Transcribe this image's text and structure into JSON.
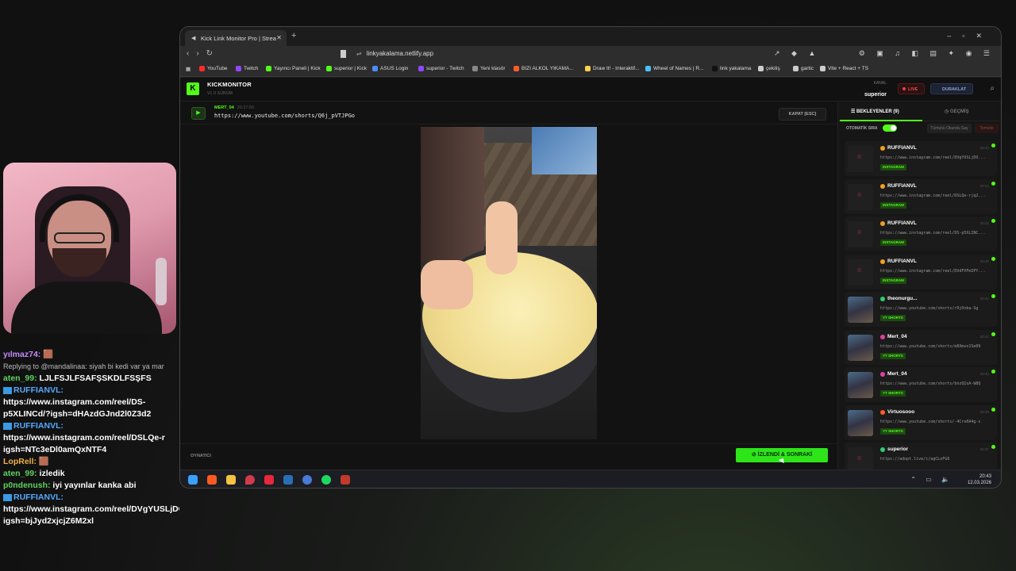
{
  "chat": [
    {
      "type": "partial",
      "text": "yılmaz74: 🟫"
    },
    {
      "type": "reply",
      "text": "Replying to @mandalinaa: siyah bi kedi var ya mar"
    },
    {
      "type": "msg",
      "user": "aten_99:",
      "user_color": "green",
      "text": "LJLFSJLFSAFŞSKDLFSŞFS"
    },
    {
      "type": "user_only",
      "user": "RUFFIANVL:",
      "user_color": "blue",
      "badge": true
    },
    {
      "type": "text_only",
      "text": "https://www.instagram.com/reel/DS-"
    },
    {
      "type": "text_only",
      "text": "p5XLINCd/?igsh=dHAzdGJnd2l0Z3d2"
    },
    {
      "type": "user_only",
      "user": "RUFFIANVL:",
      "user_color": "blue",
      "badge": true
    },
    {
      "type": "text_only",
      "text": "https://www.instagram.com/reel/DSLQe-r"
    },
    {
      "type": "text_only",
      "text": "igsh=NTc3eDl0amQxNTF4"
    },
    {
      "type": "msg",
      "user": "LopRell:",
      "user_color": "orange",
      "text": "🟫"
    },
    {
      "type": "msg",
      "user": "aten_99:",
      "user_color": "green",
      "text": "izledik"
    },
    {
      "type": "msg",
      "user": "p0ndenush:",
      "user_color": "green",
      "text": "iyi yayınlar kanka abi"
    },
    {
      "type": "user_only",
      "user": "RUFFIANVL:",
      "user_color": "blue",
      "badge": true
    },
    {
      "type": "text_only",
      "text": "https://www.instagram.com/reel/DVgYUSLjDO0/?"
    },
    {
      "type": "text_only",
      "text": "igsh=bjJyd2xjcjZ6M2xl"
    }
  ],
  "browser": {
    "tab_title": "Kick Link Monitor Pro | Strea",
    "url": "linkyakalama.netlify.app",
    "bookmarks": [
      {
        "label": "YouTube",
        "color": "#ff2a2a"
      },
      {
        "label": "Twitch",
        "color": "#9146ff"
      },
      {
        "label": "Yayıncı Paneli | Kick",
        "color": "#53fc18"
      },
      {
        "label": "superior | Kick",
        "color": "#53fc18"
      },
      {
        "label": "ASUS Login",
        "color": "#4a8cff"
      },
      {
        "label": "superior - Twitch",
        "color": "#9146ff"
      },
      {
        "label": "Yeni klasör",
        "color": "#888888"
      },
      {
        "label": "BIZI ALKOL YIKAMA...",
        "color": "#ff5a2a"
      },
      {
        "label": "Draw It! - Interaktif...",
        "color": "#ffd24a"
      },
      {
        "label": "Wheel of Names | R...",
        "color": "#4ac0ff"
      },
      {
        "label": "link yakalama",
        "color": "#111111"
      },
      {
        "label": "çekiliş",
        "color": "#cccccc"
      },
      {
        "label": "gartic",
        "color": "#cccccc"
      },
      {
        "label": "Vite + React + TS",
        "color": "#cccccc"
      }
    ]
  },
  "app": {
    "logo_letter": "K",
    "brand": "KICKMONITOR",
    "version": "V1.0 SÜRÜM",
    "channel_label": "KANAL",
    "channel_name": "superior",
    "live_label": "LIVE",
    "pause_label": "DURAKLAT",
    "now_playing": {
      "user": "MERT_04",
      "time": "20:37:56",
      "url": "https://www.youtube.com/shorts/Q6j_pVTJPGo",
      "close_label": "KAPAT [ESC]"
    },
    "player_label": "OYNATICI",
    "next_label": "İZLENDİ & SONRAKİ",
    "tabs": {
      "waiting": "BEKLEYENLER (9)",
      "history": "GEÇMİŞ"
    },
    "auto_label": "OTOMATİK SIRA",
    "mark_all_label": "Tümünü Okundu Say",
    "clear_label": "Temizle",
    "queue": [
      {
        "name": "RUFFIANVL",
        "dot": "#f0a020",
        "time": "20:42",
        "url": "https://www.instagram.com/reel/DVgYUSLjDO...",
        "badge": "INSTAGRAM",
        "thumb": "ig"
      },
      {
        "name": "RUFFIANVL",
        "dot": "#f0a020",
        "time": "20:41",
        "url": "https://www.instagram.com/reel/DSLQe-rjq2...",
        "badge": "INSTAGRAM",
        "thumb": "ig"
      },
      {
        "name": "RUFFIANVL",
        "dot": "#f0a020",
        "time": "20:41",
        "url": "https://www.instagram.com/reel/DS-p5XLINC...",
        "badge": "INSTAGRAM",
        "thumb": "ig"
      },
      {
        "name": "RUFFIANVL",
        "dot": "#f0a020",
        "time": "20:40",
        "url": "https://www.instagram.com/reel/DVdFXFmIPY...",
        "badge": "INSTAGRAM",
        "thumb": "ig"
      },
      {
        "name": "theonurgu...",
        "dot": "#2ecc71",
        "time": "20:41",
        "url": "https://www.youtube.com/shorts/r9jOvba-Sg",
        "badge": "YT SHORTS",
        "thumb": "yt"
      },
      {
        "name": "Mert_04",
        "dot": "#e040a0",
        "time": "20:41",
        "url": "https://www.youtube.com/shorts/m8Xmvo1Se09",
        "badge": "YT SHORTS",
        "thumb": "yt"
      },
      {
        "name": "Mert_04",
        "dot": "#e040a0",
        "time": "20:40",
        "url": "https://www.youtube.com/shorts/bnzQIoA-W8Q",
        "badge": "YT SHORTS",
        "thumb": "yt"
      },
      {
        "name": "Virtuosooo",
        "dot": "#ff5a2a",
        "time": "20:39",
        "url": "https://www.youtube.com/shorts/-4Cro0A4g-s",
        "badge": "YT SHORTS",
        "thumb": "yt"
      },
      {
        "name": "superior",
        "dot": "#2ecc71",
        "time": "20:37",
        "url": "https://adopt.live/c/agCLoFG6",
        "badge": "",
        "thumb": "ig"
      }
    ]
  },
  "taskbar": {
    "time": "20:43",
    "date": "12.03.2026"
  }
}
